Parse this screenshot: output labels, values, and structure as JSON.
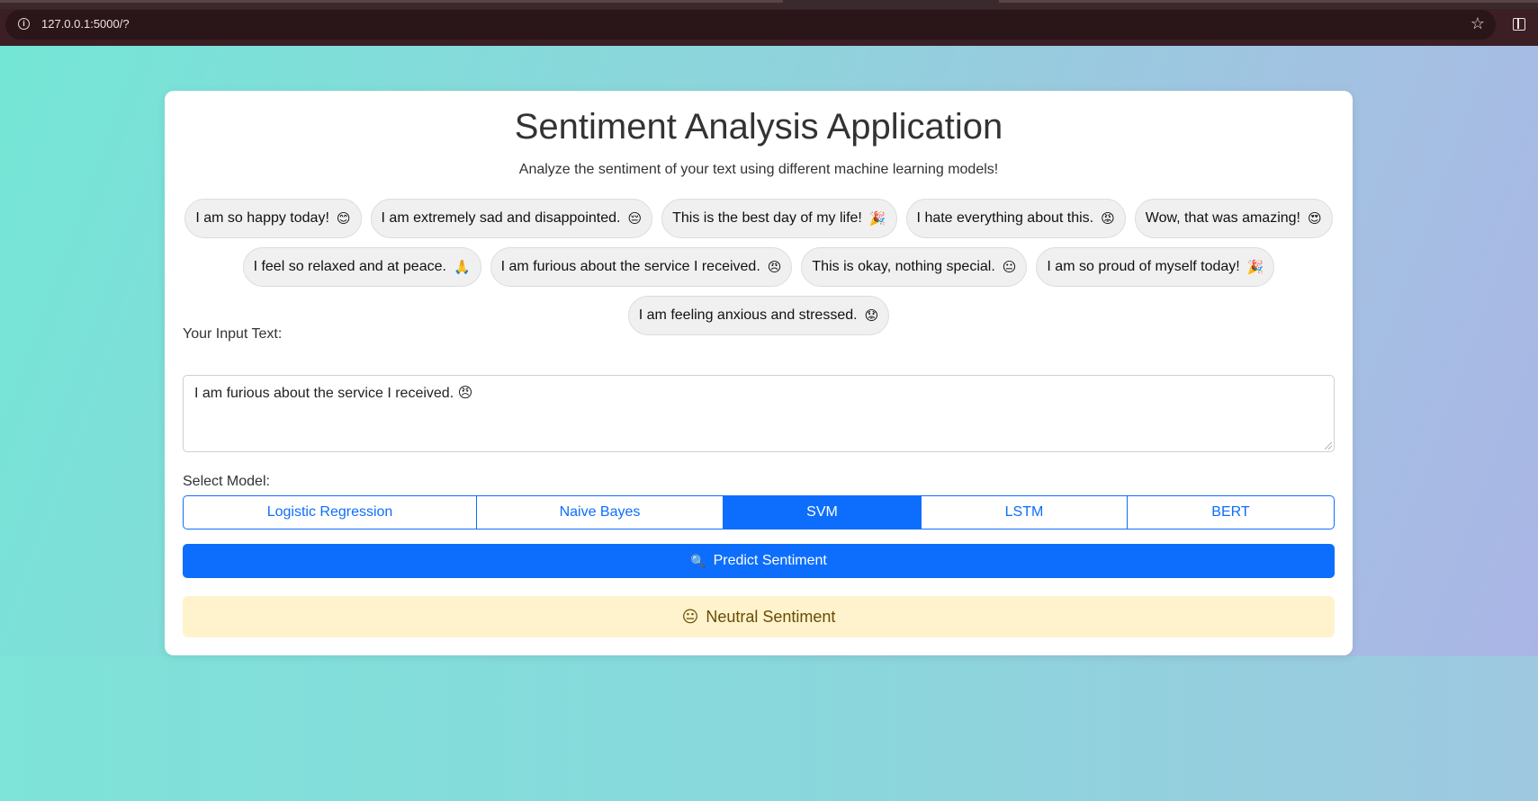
{
  "browser": {
    "url": "127.0.0.1:5000/?",
    "info_icon": "info-icon",
    "bookmark_icon": "star-icon",
    "side_panel_icon": "side-panel-icon"
  },
  "app": {
    "title": "Sentiment Analysis Application",
    "subtitle": "Analyze the sentiment of your text using different machine learning models!",
    "examples": [
      {
        "text": "I am so happy today!",
        "emoji": "😊"
      },
      {
        "text": "I am extremely sad and disappointed.",
        "emoji": "😔"
      },
      {
        "text": "This is the best day of my life!",
        "emoji": "🎉"
      },
      {
        "text": "I hate everything about this.",
        "emoji": "😡"
      },
      {
        "text": "Wow, that was amazing!",
        "emoji": "😍"
      },
      {
        "text": "I feel so relaxed and at peace.",
        "emoji": "🙏"
      },
      {
        "text": "I am furious about the service I received.",
        "emoji": "😠"
      },
      {
        "text": "This is okay, nothing special.",
        "emoji": "😐"
      },
      {
        "text": "I am so proud of myself today!",
        "emoji": "🎉"
      },
      {
        "text": "I am feeling anxious and stressed.",
        "emoji": "😟"
      }
    ],
    "input_label": "Your Input Text:",
    "input_value": "I am furious about the service I received. 😠",
    "model_label": "Select Model:",
    "models": [
      "Logistic Regression",
      "Naive Bayes",
      "SVM",
      "LSTM",
      "BERT"
    ],
    "selected_model": "SVM",
    "predict_button": {
      "icon": "🔍",
      "label": "Predict Sentiment"
    },
    "result": {
      "emoji": "😐",
      "label": "Neutral Sentiment"
    },
    "colors": {
      "primary": "#0d6efd",
      "result_bg": "#fff3cd",
      "result_text": "#664d03"
    }
  }
}
